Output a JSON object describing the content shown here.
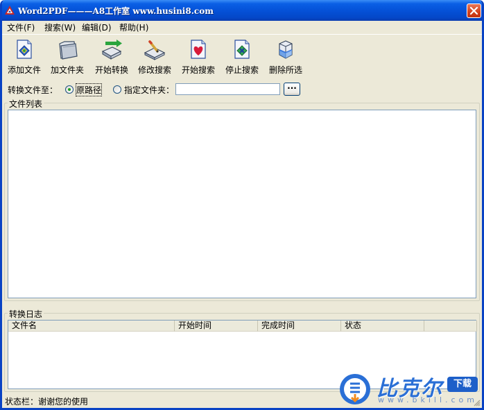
{
  "window": {
    "title": "Word2PDF———A8工作室 www.husini8.com"
  },
  "menu": {
    "items": [
      {
        "label": "文件(F)"
      },
      {
        "label": "搜索(W)"
      },
      {
        "label": "编辑(D)"
      },
      {
        "label": "帮助(H)"
      }
    ]
  },
  "toolbar": {
    "items": [
      {
        "label": "添加文件",
        "icon": "add-file-icon"
      },
      {
        "label": "加文件夹",
        "icon": "add-folder-icon"
      },
      {
        "label": "开始转换",
        "icon": "start-convert-icon"
      },
      {
        "label": "修改搜索",
        "icon": "edit-search-icon"
      },
      {
        "label": "开始搜索",
        "icon": "start-search-icon"
      },
      {
        "label": "停止搜索",
        "icon": "stop-search-icon"
      },
      {
        "label": "删除所选",
        "icon": "delete-selected-icon"
      }
    ]
  },
  "convert_to": {
    "label": "转换文件至：",
    "option_original": "原路径",
    "option_custom": "指定文件夹：",
    "selected": "原路径",
    "folder_value": "",
    "browse_label": "···"
  },
  "file_list": {
    "title": "文件列表"
  },
  "log": {
    "title": "转换日志",
    "columns": [
      "文件名",
      "开始时间",
      "完成时间",
      "状态",
      ""
    ]
  },
  "status": {
    "text": "状态栏：谢谢您的使用"
  },
  "watermark": {
    "brand": "比克尔",
    "badge": "下载",
    "url": "www.bkill.com"
  },
  "colors": {
    "titlebar": "#0552d8",
    "chrome": "#ece9d8",
    "close_button": "#d4411b",
    "watermark_blue": "#2a6fd6"
  }
}
